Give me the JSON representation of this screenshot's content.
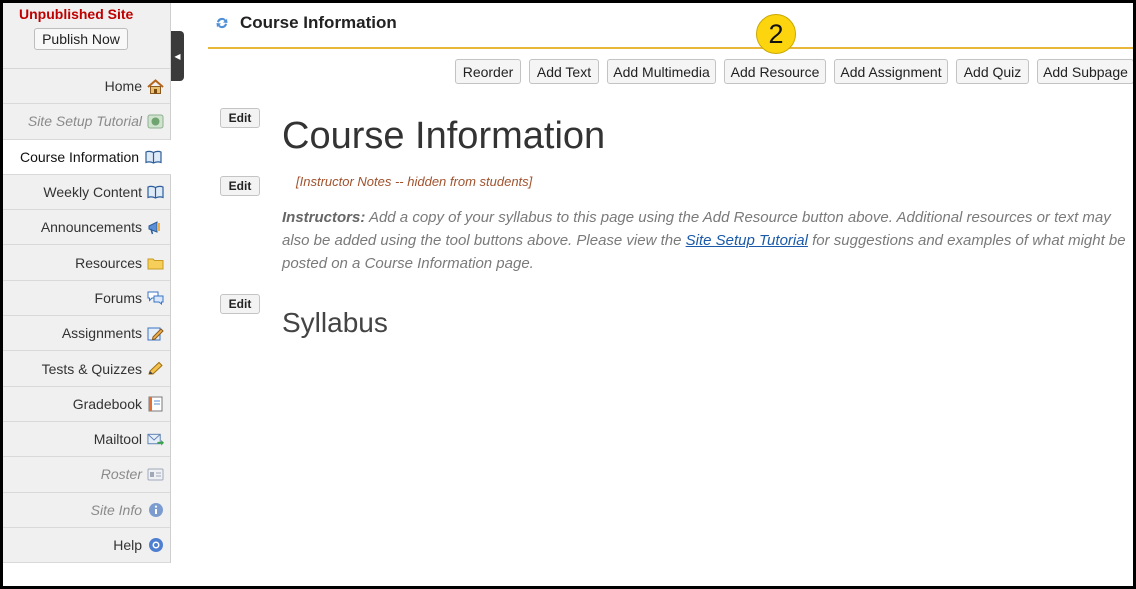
{
  "sidebar": {
    "site_status": "Unpublished Site",
    "publish_label": "Publish Now",
    "items": [
      {
        "label": "Home",
        "icon": "home-icon"
      },
      {
        "label": "Site Setup Tutorial",
        "icon": "tutorial-icon"
      },
      {
        "label": "Course Information",
        "icon": "book-icon"
      },
      {
        "label": "Weekly Content",
        "icon": "book-icon"
      },
      {
        "label": "Announcements",
        "icon": "megaphone-icon"
      },
      {
        "label": "Resources",
        "icon": "folder-icon"
      },
      {
        "label": "Forums",
        "icon": "chat-bubbles-icon"
      },
      {
        "label": "Assignments",
        "icon": "pencil-paper-icon"
      },
      {
        "label": "Tests & Quizzes",
        "icon": "pencil-icon"
      },
      {
        "label": "Gradebook",
        "icon": "gradebook-icon"
      },
      {
        "label": "Mailtool",
        "icon": "mail-arrow-icon"
      },
      {
        "label": "Roster",
        "icon": "id-card-icon"
      },
      {
        "label": "Site Info",
        "icon": "info-icon"
      },
      {
        "label": "Help",
        "icon": "help-icon"
      }
    ]
  },
  "header": {
    "title": "Course Information"
  },
  "step_badge": "2",
  "toolbar": {
    "reorder": "Reorder",
    "add_text": "Add Text",
    "add_multimedia": "Add Multimedia",
    "add_resource": "Add Resource",
    "add_assignment": "Add Assignment",
    "add_quiz": "Add Quiz",
    "add_subpage": "Add Subpage"
  },
  "content": {
    "edit_label": "Edit",
    "heading": "Course Information",
    "instructor_notes": "[Instructor Notes -- hidden from students]",
    "para_lead": "Instructors:",
    "para_text_1": " Add a copy of your syllabus to this page using the Add Resource button above. Additional resources or text may also be added using the tool buttons above. Please view the ",
    "para_link": "Site Setup Tutorial",
    "para_text_2": " for suggestions and examples of what might be posted on a Course Information page.",
    "subheading": "Syllabus"
  },
  "colors": {
    "site_status": "#c00000",
    "header_rule": "#e8b73a",
    "badge": "#fcd50f",
    "link": "#1a5aa8",
    "notes": "#a0522d"
  }
}
